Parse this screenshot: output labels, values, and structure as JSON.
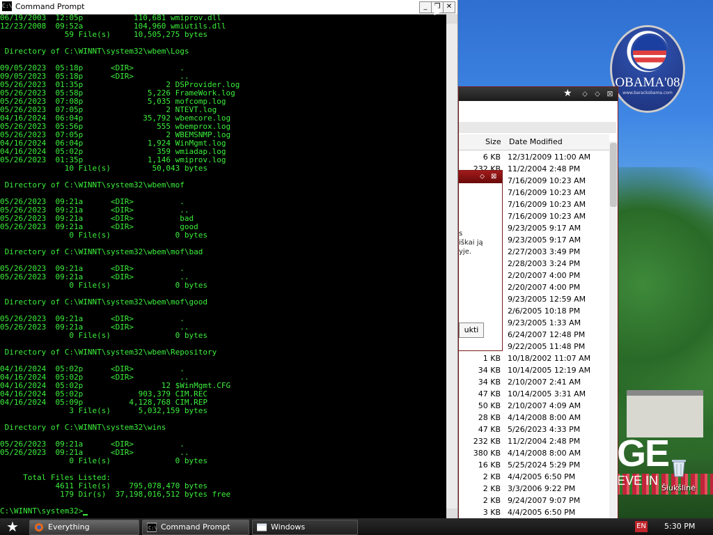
{
  "cmd": {
    "title": "Command Prompt",
    "lines": [
      "06/19/2003  12:05p           110,681 wmiprov.dll",
      "12/23/2008  09:52a           104,960 wmiutils.dll",
      "              59 File(s)     10,505,275 bytes",
      "",
      " Directory of C:\\WINNT\\system32\\wbem\\Logs",
      "",
      "09/05/2023  05:18p      <DIR>          .",
      "09/05/2023  05:18p      <DIR>          ..",
      "05/26/2023  01:35p                  2 DSProvider.log",
      "05/26/2023  05:58p              5,226 FrameWork.log",
      "05/26/2023  07:08p              5,035 mofcomp.log",
      "05/26/2023  07:05p                  2 NTEVT.log",
      "04/16/2024  06:04p             35,792 wbemcore.log",
      "05/26/2023  05:56p                555 wbemprox.log",
      "05/26/2023  07:05p                  2 WBEMSNMP.log",
      "04/16/2024  06:04p              1,924 WinMgmt.log",
      "04/16/2024  05:02p                359 wmiadap.log",
      "05/26/2023  01:35p              1,146 wmiprov.log",
      "              10 File(s)         50,043 bytes",
      "",
      " Directory of C:\\WINNT\\system32\\wbem\\mof",
      "",
      "05/26/2023  09:21a      <DIR>          .",
      "05/26/2023  09:21a      <DIR>          ..",
      "05/26/2023  09:21a      <DIR>          bad",
      "05/26/2023  09:21a      <DIR>          good",
      "               0 File(s)              0 bytes",
      "",
      " Directory of C:\\WINNT\\system32\\wbem\\mof\\bad",
      "",
      "05/26/2023  09:21a      <DIR>          .",
      "05/26/2023  09:21a      <DIR>          ..",
      "               0 File(s)              0 bytes",
      "",
      " Directory of C:\\WINNT\\system32\\wbem\\mof\\good",
      "",
      "05/26/2023  09:21a      <DIR>          .",
      "05/26/2023  09:21a      <DIR>          ..",
      "               0 File(s)              0 bytes",
      "",
      " Directory of C:\\WINNT\\system32\\wbem\\Repository",
      "",
      "04/16/2024  05:02p      <DIR>          .",
      "04/16/2024  05:02p      <DIR>          ..",
      "04/16/2024  05:02p                 12 $WinMgmt.CFG",
      "04/16/2024  05:02p            903,379 CIM.REC",
      "04/16/2024  05:09p          4,128,768 CIM.REP",
      "               3 File(s)      5,032,159 bytes",
      "",
      " Directory of C:\\WINNT\\system32\\wins",
      "",
      "05/26/2023  09:21a      <DIR>          .",
      "05/26/2023  09:21a      <DIR>          ..",
      "               0 File(s)              0 bytes",
      "",
      "     Total Files Listed:",
      "            4611 File(s)    795,078,470 bytes",
      "             179 Dir(s)  37,198,016,512 bytes free",
      "",
      "C:\\WINNT\\system32>"
    ]
  },
  "explorer": {
    "columns": {
      "size": "Size",
      "date": "Date Modified"
    },
    "rows": [
      {
        "size": "6 KB",
        "date": "12/31/2009 11:00 AM"
      },
      {
        "size": "232 KB",
        "date": "11/2/2004 2:48 PM"
      },
      {
        "size": "",
        "date": "7/16/2009 10:23 AM"
      },
      {
        "size": "",
        "date": "7/16/2009 10:23 AM"
      },
      {
        "size": "",
        "date": "7/16/2009 10:23 AM"
      },
      {
        "size": "",
        "date": "7/16/2009 10:23 AM"
      },
      {
        "size": "",
        "date": "9/23/2005 9:17 AM"
      },
      {
        "size": "",
        "date": "9/23/2005 9:17 AM"
      },
      {
        "size": "",
        "date": "2/27/2003 3:49 PM"
      },
      {
        "size": "",
        "date": "2/28/2003 3:24 PM"
      },
      {
        "size": "",
        "date": "2/20/2007 4:00 PM"
      },
      {
        "size": "",
        "date": "2/20/2007 4:00 PM"
      },
      {
        "size": "",
        "date": "9/23/2005 12:59 AM"
      },
      {
        "size": "",
        "date": "2/6/2005 10:18 PM"
      },
      {
        "size": "",
        "date": "9/23/2005 1:33 AM"
      },
      {
        "size": "",
        "date": "6/24/2007 12:48 PM"
      },
      {
        "size": "",
        "date": "9/22/2005 11:48 PM"
      },
      {
        "size": "1 KB",
        "date": "10/18/2002 11:07 AM"
      },
      {
        "size": "34 KB",
        "date": "10/14/2005 12:19 AM"
      },
      {
        "size": "34 KB",
        "date": "2/10/2007 2:41 AM"
      },
      {
        "size": "47 KB",
        "date": "10/14/2005 3:31 AM"
      },
      {
        "size": "50 KB",
        "date": "2/10/2007 4:09 AM"
      },
      {
        "size": "28 KB",
        "date": "4/14/2008 8:00 AM"
      },
      {
        "size": "47 KB",
        "date": "5/26/2023 4:33 PM"
      },
      {
        "size": "232 KB",
        "date": "11/2/2004 2:48 PM"
      },
      {
        "size": "380 KB",
        "date": "4/14/2008 8:00 AM"
      },
      {
        "size": "16 KB",
        "date": "5/25/2024 5:29 PM"
      },
      {
        "size": "2 KB",
        "date": "4/4/2005 6:50 PM"
      },
      {
        "size": "2 KB",
        "date": "3/3/2006 9:22 PM"
      },
      {
        "size": "2 KB",
        "date": "9/24/2007 9:07 PM"
      },
      {
        "size": "3 KB",
        "date": "4/4/2005 6:50 PM"
      }
    ]
  },
  "dialog": {
    "text_lines": [
      "s",
      "iškai ją",
      "yje."
    ],
    "button_label": "ukti"
  },
  "desktop": {
    "badge_text": "OBAMA'08",
    "badge_subtext": "www.barackobama.com",
    "slogan_big": "GE",
    "slogan_small": "EVE IN",
    "recycle_label": "Šiukšlinė"
  },
  "taskbar": {
    "items": [
      {
        "label": "                 Everything"
      },
      {
        "label": "Command Prompt"
      },
      {
        "label": "Windows"
      }
    ],
    "language": "EN",
    "clock": "5:30 PM"
  },
  "colors": {
    "console_text": "#3cf03c",
    "console_bg": "#000000",
    "dialog_titlebar": "#8a1212"
  }
}
